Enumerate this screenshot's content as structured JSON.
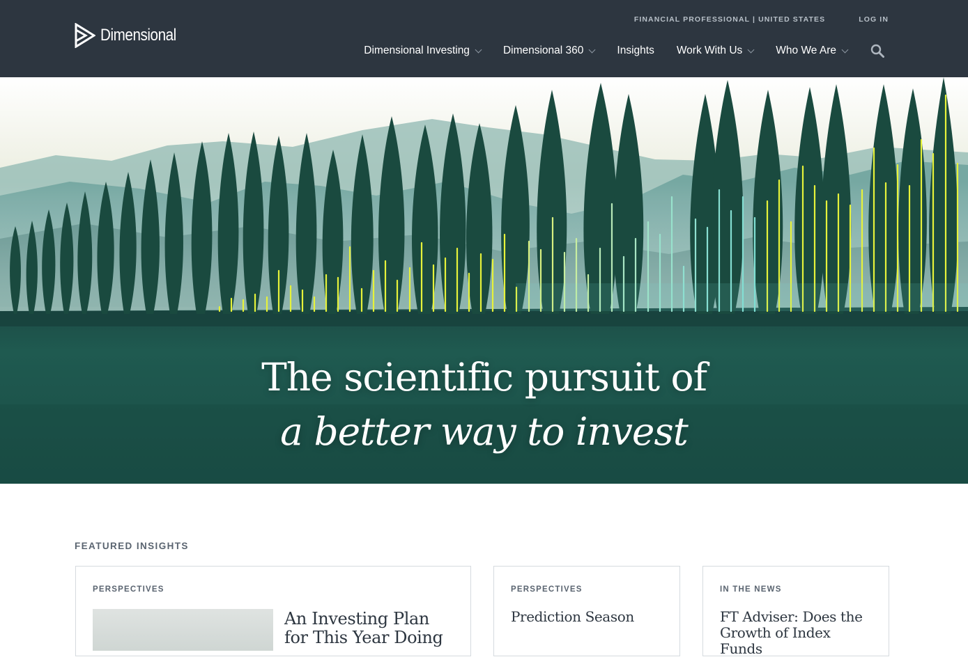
{
  "brand": {
    "name": "Dimensional"
  },
  "header": {
    "audience": "FINANCIAL PROFESSIONAL | UNITED STATES",
    "login": "LOG IN",
    "nav": [
      {
        "label": "Dimensional Investing",
        "dropdown": true
      },
      {
        "label": "Dimensional 360",
        "dropdown": true
      },
      {
        "label": "Insights",
        "dropdown": false
      },
      {
        "label": "Work With Us",
        "dropdown": true
      },
      {
        "label": "Who We Are",
        "dropdown": true
      }
    ],
    "search_icon": "search-icon"
  },
  "hero": {
    "title_line1": "The scientific pursuit of",
    "title_line2": "a better way to invest"
  },
  "featured": {
    "label": "FEATURED INSIGHTS",
    "cards": [
      {
        "category": "PERSPECTIVES",
        "title": "An Investing Plan for This Year Doing"
      },
      {
        "category": "PERSPECTIVES",
        "title": "Prediction Season"
      },
      {
        "category": "IN THE NEWS",
        "title": "FT Adviser: Does the Growth of Index Funds"
      }
    ]
  },
  "colors": {
    "header_bg": "#2d3640",
    "accent_yellow": "#e6f23a",
    "accent_teal": "#7fe0d4"
  }
}
